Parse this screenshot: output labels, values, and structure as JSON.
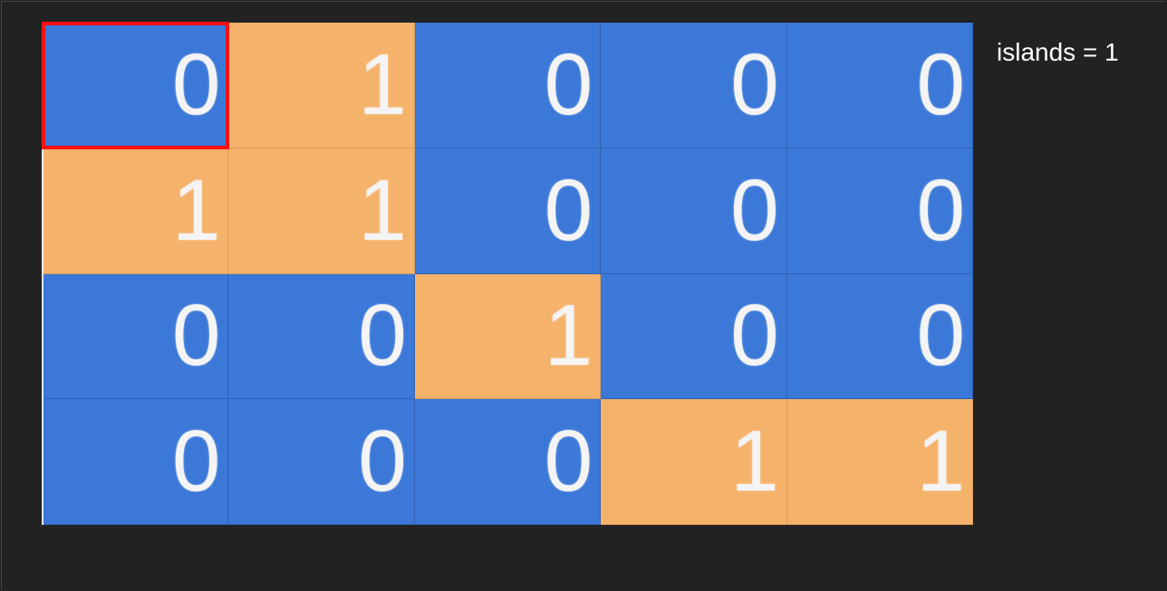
{
  "counter": {
    "label": "islands",
    "operator": "=",
    "value": "1"
  },
  "grid": {
    "rows": [
      [
        "0",
        "1",
        "0",
        "0",
        "0"
      ],
      [
        "1",
        "1",
        "0",
        "0",
        "0"
      ],
      [
        "0",
        "0",
        "1",
        "0",
        "0"
      ],
      [
        "0",
        "0",
        "0",
        "1",
        "1"
      ]
    ],
    "current_cell": {
      "row": 0,
      "col": 0
    }
  },
  "colors": {
    "water": "#3b78d8",
    "land": "#f5b26b",
    "highlight": "#ff1010",
    "background": "#222222"
  }
}
